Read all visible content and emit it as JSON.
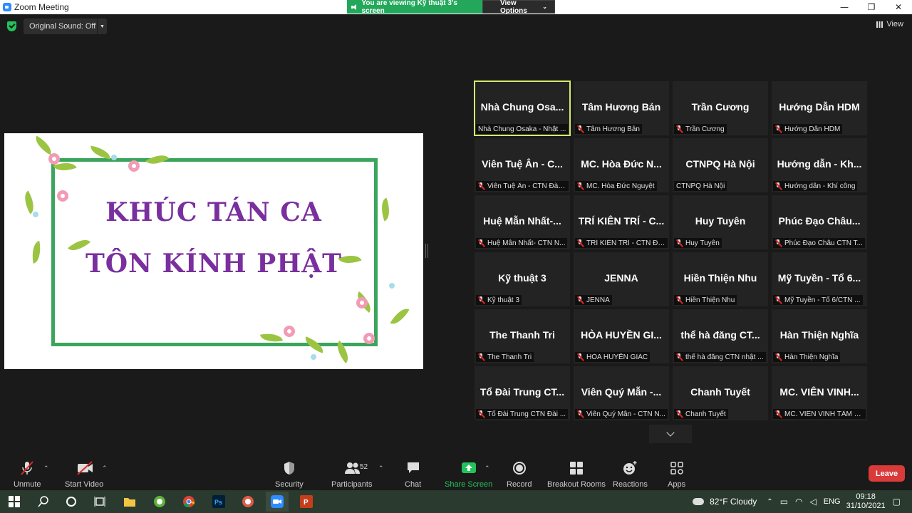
{
  "window": {
    "title": "Zoom Meeting",
    "minimize": "—",
    "maximize": "❐",
    "close": "✕"
  },
  "banner": {
    "viewing": "You are viewing Kỹ thuật 3's screen",
    "view_options": "View Options"
  },
  "topbar": {
    "original_sound": "Original Sound: Off",
    "view_label": "View"
  },
  "shared_content": {
    "line1": "KHÚC TÁN CA",
    "line2": "TÔN KÍNH PHẬT"
  },
  "participants": [
    {
      "name": "Nhà Chung Osa...",
      "label": "Nhà Chung Osaka - Nhật ...",
      "muted": false,
      "active": true
    },
    {
      "name": "Tâm Hương Bản",
      "label": "Tâm Hương Bản",
      "muted": true
    },
    {
      "name": "Trần Cương",
      "label": "Trần Cương",
      "muted": true
    },
    {
      "name": "Hướng Dẫn HDM",
      "label": "Hướng Dẫn HDM",
      "muted": true
    },
    {
      "name": "Viên Tuệ Ân - C...",
      "label": "Viên Tuệ Ân - CTN Đài ...",
      "muted": true
    },
    {
      "name": "MC. Hòa Đức N...",
      "label": "MC. Hòa Đức Nguyệt",
      "muted": true
    },
    {
      "name": "CTNPQ Hà Nội",
      "label": "CTNPQ Hà Nội",
      "muted": false
    },
    {
      "name": "Hướng dẫn - Kh...",
      "label": "Hướng dẫn - Khí công",
      "muted": true
    },
    {
      "name": "Huệ Mẫn Nhất-...",
      "label": "Huệ Mẫn Nhất- CTN N...",
      "muted": true
    },
    {
      "name": "TRÍ KIÊN TRÍ - C...",
      "label": "TRÍ KIÊN TRÍ - CTN ĐÀI...",
      "muted": true
    },
    {
      "name": "Huy Tuyên",
      "label": "Huy Tuyên",
      "muted": true
    },
    {
      "name": "Phúc Đạo Châu...",
      "label": "Phúc Đạo Châu CTN T...",
      "muted": true
    },
    {
      "name": "Kỹ thuật 3",
      "label": "Kỹ thuật 3",
      "muted": true
    },
    {
      "name": "JENNA",
      "label": "JENNA",
      "muted": true
    },
    {
      "name": "Hiền Thiện Nhu",
      "label": "Hiền Thiện Nhu",
      "muted": true
    },
    {
      "name": "Mỹ Tuyền - Tổ 6...",
      "label": "Mỹ Tuyền - Tổ 6/CTN ...",
      "muted": true
    },
    {
      "name": "The Thanh Tri",
      "label": "The Thanh Tri",
      "muted": true
    },
    {
      "name": "HÒA HUYỀN GI...",
      "label": "HÒA HUYỀN GIÁC",
      "muted": true
    },
    {
      "name": "thể hà đăng CT...",
      "label": "thể hà đăng CTN nhật ...",
      "muted": true
    },
    {
      "name": "Hàn Thiện Nghĩa",
      "label": "Hàn Thiện Nghĩa",
      "muted": true
    },
    {
      "name": "Tổ Đài Trung CT...",
      "label": "Tổ Đài Trung CTN Đài ...",
      "muted": true
    },
    {
      "name": "Viên Quý Mẫn -...",
      "label": "Viên Quý Mẫn - CTN N...",
      "muted": true
    },
    {
      "name": "Chanh Tuyết",
      "label": "Chanh Tuyết",
      "muted": true
    },
    {
      "name": "MC. VIÊN VINH...",
      "label": "MC. VIÊN VINH TÂM C...",
      "muted": true
    }
  ],
  "toolbar": {
    "unmute": "Unmute",
    "start_video": "Start Video",
    "security": "Security",
    "participants": "Participants",
    "participants_count": "52",
    "chat": "Chat",
    "share_screen": "Share Screen",
    "record": "Record",
    "breakout_rooms": "Breakout Rooms",
    "reactions": "Reactions",
    "apps": "Apps",
    "leave": "Leave"
  },
  "taskbar": {
    "weather": "82°F  Cloudy",
    "lang": "ENG",
    "time": "09:18",
    "date": "31/10/2021"
  },
  "colors": {
    "accent_green": "#23a85b",
    "leave_red": "#d93a3a",
    "active_outline": "#d7e96b",
    "title_purple": "#7a2f9e"
  }
}
